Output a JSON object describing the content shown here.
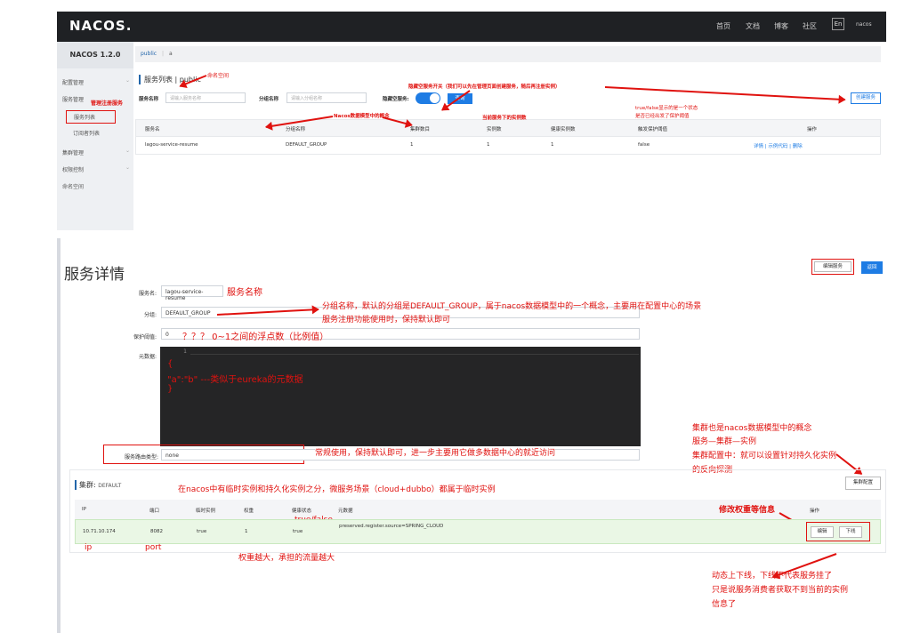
{
  "console": {
    "logo": "NACOS.",
    "nav": [
      "首页",
      "文档",
      "博客",
      "社区"
    ],
    "lang": "En",
    "user": "nacos",
    "version": "NACOS 1.2.0",
    "sidebar": [
      "配置管理",
      "服务管理",
      "服务列表",
      "订阅者列表",
      "集群管理",
      "权限控制",
      "命名空间"
    ],
    "breadcrumb_ns": "public",
    "breadcrumb_sep": "|",
    "breadcrumb_extra": "a",
    "title": "服务列表 | public",
    "search_name_label": "服务名称",
    "search_name_placeholder": "请输入服务名称",
    "search_group_label": "分组名称",
    "search_group_placeholder": "请输入分组名称",
    "hide_empty_label": "隐藏空服务:",
    "query_btn": "查询",
    "create_btn": "创建服务",
    "columns": [
      "服务名",
      "分组名称",
      "集群数目",
      "实例数",
      "健康实例数",
      "触发保护阈值",
      "操作"
    ],
    "row": [
      "lagou-service-resume",
      "DEFAULT_GROUP",
      "1",
      "1",
      "1",
      "false"
    ],
    "ops": "详情 | 示例代码 | 删除"
  },
  "console_annotations": {
    "namespace": "命名空间",
    "manage": "管理注册服务",
    "hide_switch": "隐藏空服务开关（我们可以先在管理页面创建服务，随后再注册实例）",
    "model": "Nacos数据模型中的概念",
    "instances": "当前服务下的实例数",
    "protect1": "true/false显示的是一个状态",
    "protect2": "是否已经出发了保护阈值"
  },
  "detail": {
    "title": "服务详情",
    "edit_btn": "编辑服务",
    "back_btn": "返回",
    "name_label": "服务名:",
    "name_value": "lagou-service-resume",
    "group_label": "分组:",
    "group_value": "DEFAULT_GROUP",
    "protect_label": "保护阈值:",
    "protect_value": "0",
    "meta_label": "元数据:",
    "line_no": "1",
    "selector_label": "服务路由类型:",
    "selector_value": "none",
    "cluster_title": "集群:",
    "cluster_name": "DEFAULT",
    "cluster_cfg_btn": "集群配置",
    "columns": [
      "IP",
      "端口",
      "临时实例",
      "权重",
      "健康状态",
      "元数据",
      "操作"
    ],
    "row": [
      "10.71.10.174",
      "8082",
      "true",
      "1",
      "true",
      "preserved.register.source=SPRING_CLOUD"
    ],
    "btn_edit": "编辑",
    "btn_offline": "下线"
  },
  "detail_annotations": {
    "name": "服务名称",
    "group1": "分组名称，默认的分组是DEFAULT_GROUP，属于nacos数据模型中的一个概念，主要用在配置中心的场景",
    "group2": "服务注册功能使用时，保持默认即可",
    "protect": "？？？ 0~1之间的浮点数（比例值）",
    "meta1": "{",
    "meta2": "\"a\":\"b\"  ---类似于eureka的元数据",
    "meta3": "}",
    "selector": "常规使用，保持默认即可，进一步主要用它做多数据中心的就近访问",
    "cluster1": "集群也是nacos数据模型中的概念",
    "cluster2": "服务—集群—实例",
    "cluster3": "集群配置中：就可以设置针对持久化实例",
    "cluster4": "的反向探测",
    "ephemeral": "在nacos中有临时实例和持久化实例之分，微服务场景（cloud+dubbo）都属于临时实例",
    "health": "true/false",
    "weight_edit": "修改权重等信息",
    "ip": "ip",
    "port": "port",
    "weight": "权重越大，承担的流量越大",
    "offline1": "动态上下线，下线不代表服务挂了",
    "offline2": "只是说服务消费者获取不到当前的实例",
    "offline3": "信息了"
  },
  "colors": {
    "accent": "#1e7ce4",
    "annotation": "#e0120f",
    "topbar": "#1f2124"
  }
}
